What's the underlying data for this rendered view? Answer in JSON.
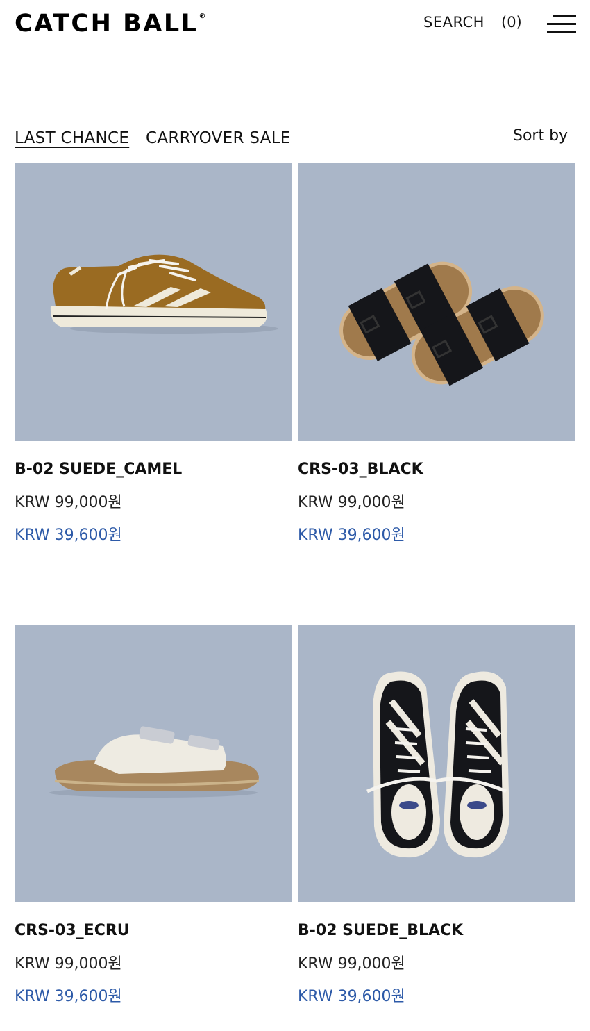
{
  "header": {
    "logo": "CATCH BALL",
    "logo_mark": "®",
    "search_label": "SEARCH",
    "cart_count": "(0)"
  },
  "tabs": [
    {
      "label": "LAST CHANCE",
      "active": true
    },
    {
      "label": "CARRYOVER SALE",
      "active": false
    }
  ],
  "sort_label": "Sort by",
  "colors": {
    "image_bg": "#aab6c8",
    "sale_price": "#2d5aa8",
    "text": "#111111"
  },
  "products": [
    {
      "name": "B-02 SUEDE_CAMEL",
      "price": "KRW 99,000원",
      "sale_price": "KRW 39,600원",
      "image": "camel-suede-sneaker"
    },
    {
      "name": "CRS-03_BLACK",
      "price": "KRW 99,000원",
      "sale_price": "KRW 39,600원",
      "image": "black-buckle-sandals"
    },
    {
      "name": "CRS-03_ECRU",
      "price": "KRW 99,000원",
      "sale_price": "KRW 39,600원",
      "image": "ecru-buckle-sandal"
    },
    {
      "name": "B-02 SUEDE_BLACK",
      "price": "KRW 99,000원",
      "sale_price": "KRW 39,600원",
      "image": "black-suede-sneakers-pair"
    }
  ]
}
